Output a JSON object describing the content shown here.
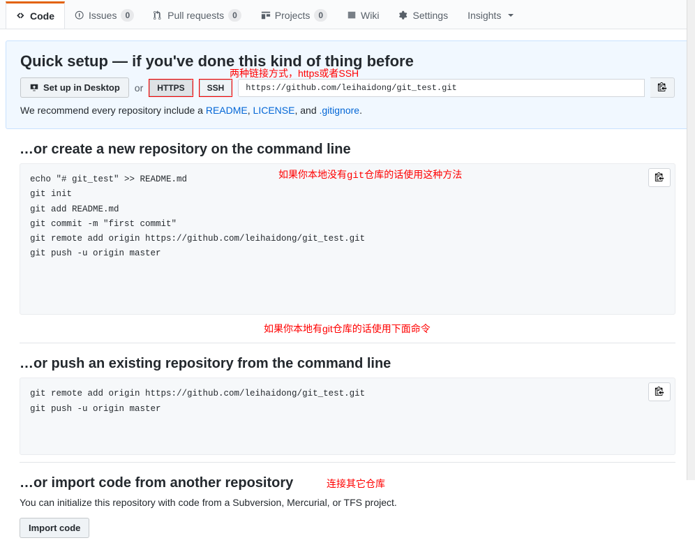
{
  "tabs": {
    "code": "Code",
    "issues": "Issues",
    "issues_count": "0",
    "pulls": "Pull requests",
    "pulls_count": "0",
    "projects": "Projects",
    "projects_count": "0",
    "wiki": "Wiki",
    "settings": "Settings",
    "insights": "Insights"
  },
  "quick": {
    "title": "Quick setup — if you've done this kind of thing before",
    "desktop_btn": "Set up in Desktop",
    "or": "or",
    "https": "HTTPS",
    "ssh": "SSH",
    "url": "https://github.com/leihaidong/git_test.git",
    "recommend_pre": "We recommend every repository include a ",
    "readme": "README",
    "license": "LICENSE",
    "gitignore": ".gitignore",
    "comma": ", ",
    "and": ", and ",
    "period": "."
  },
  "annotations": {
    "protocol": "两种链接方式，https或者SSH",
    "no_repo": "如果你本地没有git仓库的话使用这种方法",
    "has_repo": "如果你本地有git仓库的话使用下面命令",
    "import": "连接其它仓库"
  },
  "create": {
    "title": "…or create a new repository on the command line",
    "code": "echo \"# git_test\" >> README.md\ngit init\ngit add README.md\ngit commit -m \"first commit\"\ngit remote add origin https://github.com/leihaidong/git_test.git\ngit push -u origin master"
  },
  "push": {
    "title": "…or push an existing repository from the command line",
    "code": "git remote add origin https://github.com/leihaidong/git_test.git\ngit push -u origin master"
  },
  "import": {
    "title": "…or import code from another repository",
    "desc": "You can initialize this repository with code from a Subversion, Mercurial, or TFS project.",
    "btn": "Import code"
  }
}
